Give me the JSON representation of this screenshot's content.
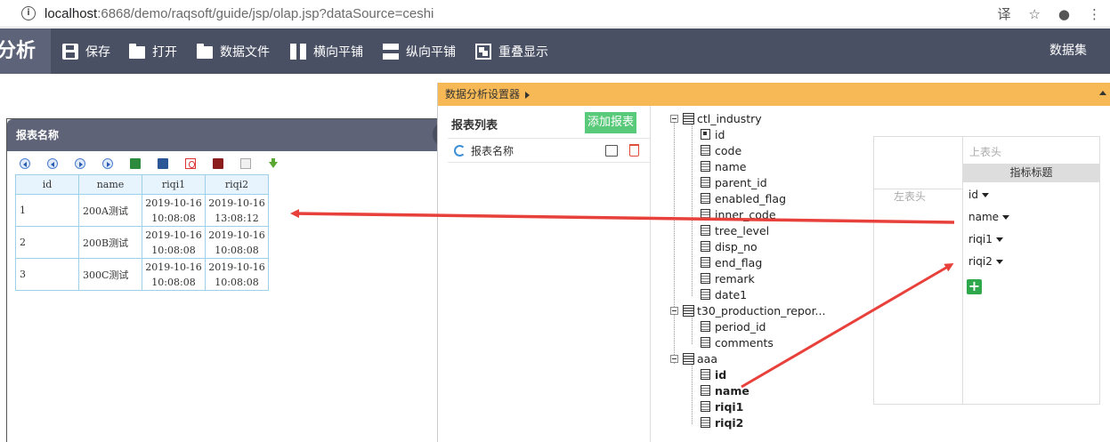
{
  "browser": {
    "url_host": "localhost",
    "url_path": ":6868/demo/raqsoft/guide/jsp/olap.jsp?dataSource=ceshi"
  },
  "toolbar": {
    "brand": "分析",
    "buttons": [
      {
        "label": "保存",
        "icon": "save-icon"
      },
      {
        "label": "打开",
        "icon": "folder-open-icon"
      },
      {
        "label": "数据文件",
        "icon": "folder-icon"
      },
      {
        "label": "横向平铺",
        "icon": "tile-horizontal-icon"
      },
      {
        "label": "纵向平铺",
        "icon": "tile-vertical-icon"
      },
      {
        "label": "重叠显示",
        "icon": "overlay-icon"
      }
    ],
    "dataset_label": "数据集"
  },
  "report_window": {
    "title": "报表名称",
    "columns": [
      "id",
      "name",
      "riqi1",
      "riqi2"
    ],
    "rows": [
      {
        "id": "1",
        "name": "200A测试",
        "riqi1_date": "2019-10-16",
        "riqi1_time": "10:08:08",
        "riqi2_date": "2019-10-16",
        "riqi2_time": "13:08:12"
      },
      {
        "id": "2",
        "name": "200B测试",
        "riqi1_date": "2019-10-16",
        "riqi1_time": "10:08:08",
        "riqi2_date": "2019-10-16",
        "riqi2_time": "10:08:08"
      },
      {
        "id": "3",
        "name": "300C测试",
        "riqi1_date": "2019-10-16",
        "riqi1_time": "10:08:08",
        "riqi2_date": "2019-10-16",
        "riqi2_time": "10:08:08"
      }
    ]
  },
  "setter": {
    "title": "数据分析设置器",
    "report_list_title": "报表列表",
    "add_report_label": "添加报表",
    "report_item": "报表名称",
    "tree": {
      "ctl_industry": {
        "name": "ctl_industry",
        "fields": [
          "id",
          "code",
          "name",
          "parent_id",
          "enabled_flag",
          "inner_code",
          "tree_level",
          "disp_no",
          "end_flag",
          "remark",
          "date1"
        ]
      },
      "t30": {
        "name": "t30_production_repor...",
        "fields": [
          "period_id",
          "comments"
        ]
      },
      "aaa": {
        "name": "aaa",
        "fields": [
          "id",
          "name",
          "riqi1",
          "riqi2"
        ]
      }
    },
    "grid": {
      "top_header": "上表头",
      "metric_header": "指标标题",
      "left_header": "左表头",
      "metrics": [
        "id",
        "name",
        "riqi1",
        "riqi2"
      ]
    }
  },
  "colors": {
    "toolbar_bg": "#4a5064",
    "setter_header": "#f7b955",
    "add_button": "#59c97a",
    "arrow": "#e8403a"
  }
}
